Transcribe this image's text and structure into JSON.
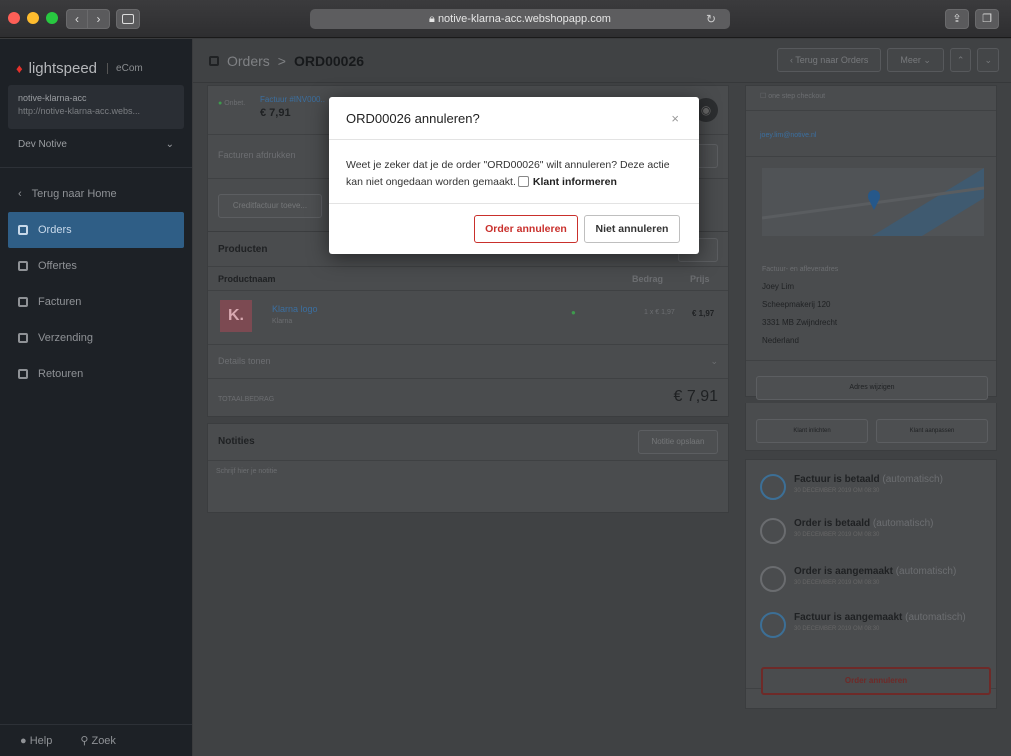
{
  "browser": {
    "url": "notive-klarna-acc.webshopapp.com",
    "lights": [
      "#fe5f57",
      "#febc2e",
      "#28c840"
    ]
  },
  "sidebar": {
    "brand": "lightspeed",
    "brand_sub": "eCom",
    "shop_name": "notive-klarna-acc",
    "shop_url": "http://notive-klarna-acc.webs...",
    "env": "Dev Notive",
    "back_home": "Terug naar Home",
    "items": [
      {
        "label": "Orders",
        "active": true
      },
      {
        "label": "Offertes"
      },
      {
        "label": "Facturen"
      },
      {
        "label": "Verzending"
      },
      {
        "label": "Retouren"
      }
    ],
    "help": "Help",
    "search": "Zoek"
  },
  "topbar": {
    "crumb_parent": "Orders",
    "crumb_sep": ">",
    "crumb_current": "ORD00026",
    "back_button": "Terug naar Orders",
    "more_button": "Meer"
  },
  "invoice": {
    "status": "Onbet.",
    "label": "Factuur #INV000..",
    "amount": "€ 7,91",
    "print_link": "Facturen afdrukken",
    "credit_button": "Creditfactuur toeve..."
  },
  "products": {
    "title": "Producten",
    "headers": [
      "Productnaam",
      "Bedrag",
      "Prijs"
    ],
    "rows": [
      {
        "name": "Klarna logo",
        "sub": "Klarna",
        "qty_price": "1 x € 1,97",
        "price": "€ 1,97"
      }
    ],
    "details": "Details tonen",
    "total_label": "TOTAALBEDRAG",
    "total_value": "€ 7,91"
  },
  "notes": {
    "title": "Notities",
    "save_button": "Notitie opslaan",
    "placeholder": "Schrijf hier je notitie"
  },
  "customer": {
    "checkout": "one step checkout",
    "email": "joey.lim@notive.nl",
    "address_title": "Factuur- en afleveradres",
    "address_lines": [
      "Joey Lim",
      "Scheepmakerij 120",
      "3331 MB Zwijndrecht",
      "Nederland"
    ],
    "edit_address": "Adres wijzigen",
    "customer_info": "Klant inlichten",
    "customer_edit": "Klant aanpassen"
  },
  "timeline": [
    {
      "title": "Factuur is betaald",
      "note": "(automatisch)",
      "date": "30 DECEMBER 2019 OM 08:30",
      "blue": true
    },
    {
      "title": "Order is betaald",
      "note": "(automatisch)",
      "date": "30 DECEMBER 2019 OM 08:30",
      "blue": false
    },
    {
      "title": "Order is aangemaakt",
      "note": "(automatisch)",
      "date": "30 DECEMBER 2019 OM 08:30",
      "blue": false
    },
    {
      "title": "Factuur is aangemaakt",
      "note": "(automatisch)",
      "date": "30 DECEMBER 2019 OM 08:30",
      "blue": true
    }
  ],
  "cancel_order_button": "Order annuleren",
  "modal": {
    "title": "ORD00026 annuleren?",
    "close": "×",
    "body_text": "Weet je zeker dat je de order \"ORD00026\" wilt annuleren? Deze actie kan niet ongedaan worden gemaakt.",
    "checkbox_label": "Klant informeren",
    "confirm_button": "Order annuleren",
    "cancel_button": "Niet annuleren"
  }
}
